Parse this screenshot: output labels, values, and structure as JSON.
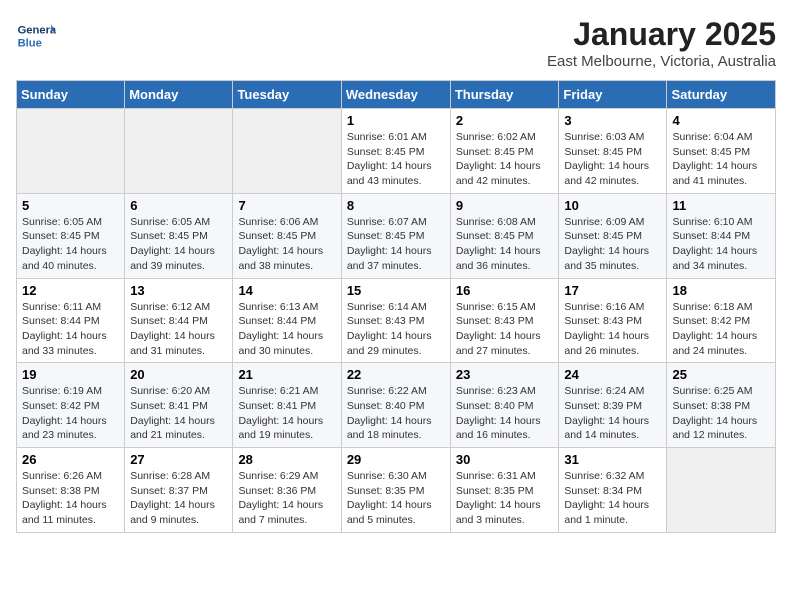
{
  "header": {
    "logo_text_general": "General",
    "logo_text_blue": "Blue",
    "month_year": "January 2025",
    "location": "East Melbourne, Victoria, Australia"
  },
  "days_of_week": [
    "Sunday",
    "Monday",
    "Tuesday",
    "Wednesday",
    "Thursday",
    "Friday",
    "Saturday"
  ],
  "weeks": [
    [
      {
        "day": "",
        "info": ""
      },
      {
        "day": "",
        "info": ""
      },
      {
        "day": "",
        "info": ""
      },
      {
        "day": "1",
        "info": "Sunrise: 6:01 AM\nSunset: 8:45 PM\nDaylight: 14 hours\nand 43 minutes."
      },
      {
        "day": "2",
        "info": "Sunrise: 6:02 AM\nSunset: 8:45 PM\nDaylight: 14 hours\nand 42 minutes."
      },
      {
        "day": "3",
        "info": "Sunrise: 6:03 AM\nSunset: 8:45 PM\nDaylight: 14 hours\nand 42 minutes."
      },
      {
        "day": "4",
        "info": "Sunrise: 6:04 AM\nSunset: 8:45 PM\nDaylight: 14 hours\nand 41 minutes."
      }
    ],
    [
      {
        "day": "5",
        "info": "Sunrise: 6:05 AM\nSunset: 8:45 PM\nDaylight: 14 hours\nand 40 minutes."
      },
      {
        "day": "6",
        "info": "Sunrise: 6:05 AM\nSunset: 8:45 PM\nDaylight: 14 hours\nand 39 minutes."
      },
      {
        "day": "7",
        "info": "Sunrise: 6:06 AM\nSunset: 8:45 PM\nDaylight: 14 hours\nand 38 minutes."
      },
      {
        "day": "8",
        "info": "Sunrise: 6:07 AM\nSunset: 8:45 PM\nDaylight: 14 hours\nand 37 minutes."
      },
      {
        "day": "9",
        "info": "Sunrise: 6:08 AM\nSunset: 8:45 PM\nDaylight: 14 hours\nand 36 minutes."
      },
      {
        "day": "10",
        "info": "Sunrise: 6:09 AM\nSunset: 8:45 PM\nDaylight: 14 hours\nand 35 minutes."
      },
      {
        "day": "11",
        "info": "Sunrise: 6:10 AM\nSunset: 8:44 PM\nDaylight: 14 hours\nand 34 minutes."
      }
    ],
    [
      {
        "day": "12",
        "info": "Sunrise: 6:11 AM\nSunset: 8:44 PM\nDaylight: 14 hours\nand 33 minutes."
      },
      {
        "day": "13",
        "info": "Sunrise: 6:12 AM\nSunset: 8:44 PM\nDaylight: 14 hours\nand 31 minutes."
      },
      {
        "day": "14",
        "info": "Sunrise: 6:13 AM\nSunset: 8:44 PM\nDaylight: 14 hours\nand 30 minutes."
      },
      {
        "day": "15",
        "info": "Sunrise: 6:14 AM\nSunset: 8:43 PM\nDaylight: 14 hours\nand 29 minutes."
      },
      {
        "day": "16",
        "info": "Sunrise: 6:15 AM\nSunset: 8:43 PM\nDaylight: 14 hours\nand 27 minutes."
      },
      {
        "day": "17",
        "info": "Sunrise: 6:16 AM\nSunset: 8:43 PM\nDaylight: 14 hours\nand 26 minutes."
      },
      {
        "day": "18",
        "info": "Sunrise: 6:18 AM\nSunset: 8:42 PM\nDaylight: 14 hours\nand 24 minutes."
      }
    ],
    [
      {
        "day": "19",
        "info": "Sunrise: 6:19 AM\nSunset: 8:42 PM\nDaylight: 14 hours\nand 23 minutes."
      },
      {
        "day": "20",
        "info": "Sunrise: 6:20 AM\nSunset: 8:41 PM\nDaylight: 14 hours\nand 21 minutes."
      },
      {
        "day": "21",
        "info": "Sunrise: 6:21 AM\nSunset: 8:41 PM\nDaylight: 14 hours\nand 19 minutes."
      },
      {
        "day": "22",
        "info": "Sunrise: 6:22 AM\nSunset: 8:40 PM\nDaylight: 14 hours\nand 18 minutes."
      },
      {
        "day": "23",
        "info": "Sunrise: 6:23 AM\nSunset: 8:40 PM\nDaylight: 14 hours\nand 16 minutes."
      },
      {
        "day": "24",
        "info": "Sunrise: 6:24 AM\nSunset: 8:39 PM\nDaylight: 14 hours\nand 14 minutes."
      },
      {
        "day": "25",
        "info": "Sunrise: 6:25 AM\nSunset: 8:38 PM\nDaylight: 14 hours\nand 12 minutes."
      }
    ],
    [
      {
        "day": "26",
        "info": "Sunrise: 6:26 AM\nSunset: 8:38 PM\nDaylight: 14 hours\nand 11 minutes."
      },
      {
        "day": "27",
        "info": "Sunrise: 6:28 AM\nSunset: 8:37 PM\nDaylight: 14 hours\nand 9 minutes."
      },
      {
        "day": "28",
        "info": "Sunrise: 6:29 AM\nSunset: 8:36 PM\nDaylight: 14 hours\nand 7 minutes."
      },
      {
        "day": "29",
        "info": "Sunrise: 6:30 AM\nSunset: 8:35 PM\nDaylight: 14 hours\nand 5 minutes."
      },
      {
        "day": "30",
        "info": "Sunrise: 6:31 AM\nSunset: 8:35 PM\nDaylight: 14 hours\nand 3 minutes."
      },
      {
        "day": "31",
        "info": "Sunrise: 6:32 AM\nSunset: 8:34 PM\nDaylight: 14 hours\nand 1 minute."
      },
      {
        "day": "",
        "info": ""
      }
    ]
  ]
}
